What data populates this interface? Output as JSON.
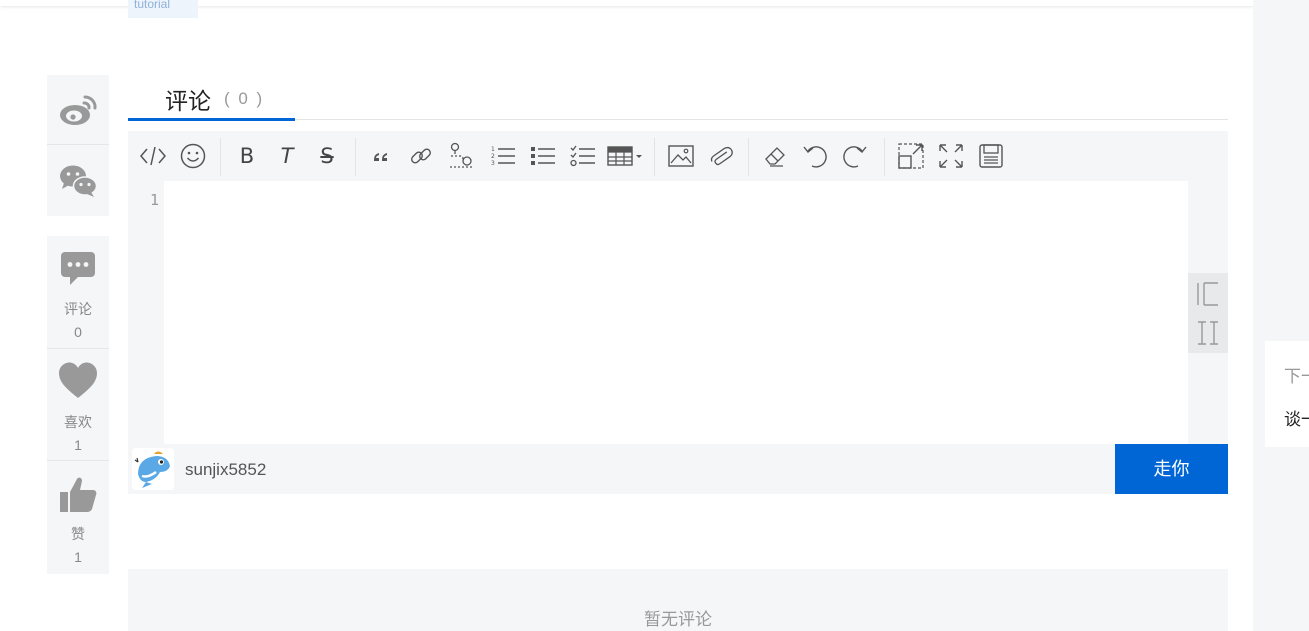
{
  "top": {
    "tag_text": "tutorial"
  },
  "share": {
    "weibo_icon": "weibo-icon",
    "wechat_icon": "wechat-icon"
  },
  "actions": {
    "comment": {
      "label": "评论",
      "count": "0",
      "icon": "comment-icon"
    },
    "like": {
      "label": "喜欢",
      "count": "1",
      "icon": "heart-icon"
    },
    "thumb": {
      "label": "赞",
      "count": "1",
      "icon": "thumbs-up-icon"
    }
  },
  "comments": {
    "title": "评论",
    "count": "( 0 )",
    "empty_text": "暂无评论"
  },
  "editor": {
    "toolbar": [
      "code-icon",
      "emoji-icon",
      "bold-icon",
      "italic-icon",
      "strikethrough-icon",
      "quote-icon",
      "link-icon",
      "location-icon",
      "ordered-list-icon",
      "unordered-list-icon",
      "checklist-icon",
      "table-icon",
      "image-icon",
      "attachment-icon",
      "eraser-icon",
      "undo-icon",
      "redo-icon",
      "fullscreen-icon",
      "expand-icon",
      "save-icon"
    ],
    "bold_label": "B",
    "italic_label": "T",
    "strike_label": "S",
    "line_number": "1",
    "username": "sunjix5852",
    "submit_label": "走你"
  },
  "next": {
    "label": "下一篇",
    "title": "谈一谈"
  },
  "colors": {
    "accent": "#0066d6",
    "panel": "#f5f6f7",
    "icon": "#999999"
  }
}
